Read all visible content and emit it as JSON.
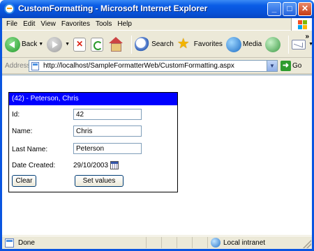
{
  "window": {
    "title": "CustomFormatting - Microsoft Internet Explorer",
    "minimize_glyph": "_",
    "maximize_glyph": "□",
    "close_glyph": "✕"
  },
  "menu": {
    "items": [
      {
        "label": "File"
      },
      {
        "label": "Edit"
      },
      {
        "label": "View"
      },
      {
        "label": "Favorites"
      },
      {
        "label": "Tools"
      },
      {
        "label": "Help"
      }
    ]
  },
  "toolbar": {
    "back_label": "Back",
    "search_label": "Search",
    "favorites_label": "Favorites",
    "media_label": "Media",
    "chevron": "»"
  },
  "address": {
    "label": "Address",
    "url": "http://localhost/SampleFormatterWeb/CustomFormatting.aspx",
    "go_label": "Go"
  },
  "form": {
    "header": "(42) - Peterson, Chris",
    "id_label": "Id:",
    "id_value": "42",
    "name_label": "Name:",
    "name_value": "Chris",
    "last_name_label": "Last Name:",
    "last_name_value": "Peterson",
    "date_label": "Date Created:",
    "date_value": "29/10/2003",
    "clear_label": "Clear",
    "set_values_label": "Set values"
  },
  "status": {
    "text": "Done",
    "zone": "Local intranet"
  },
  "colors": {
    "title_bar": "#0a5ce6",
    "form_header": "#0000ff",
    "chrome": "#ece9d8"
  }
}
